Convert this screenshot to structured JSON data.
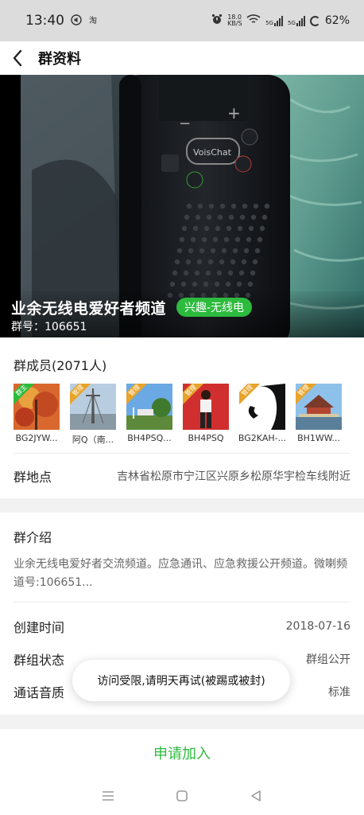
{
  "status_bar": {
    "time": "13:40",
    "net_speed_top": "18.0",
    "net_speed_bottom": "KB/S",
    "signal_label_1": "5G",
    "signal_label_2": "5G",
    "battery": "62%"
  },
  "header": {
    "title": "群资料"
  },
  "cover": {
    "group_name": "业余无线电爱好者频道",
    "tag": "兴趣-无线电",
    "group_id": "群号：106651"
  },
  "members": {
    "title": "群成员(2071人)",
    "badge_owner": "群主",
    "badge_admin": "管理",
    "list": [
      {
        "name": "BG2JYW...",
        "badge": "群主"
      },
      {
        "name": "阿Q（南...",
        "badge": "管理"
      },
      {
        "name": "BH4PSQ...",
        "badge": "管理"
      },
      {
        "name": "BH4PSQ",
        "badge": "管理"
      },
      {
        "name": "BG2KAH-...",
        "badge": "管理"
      },
      {
        "name": "BH1WW...",
        "badge": "管理"
      }
    ]
  },
  "location": {
    "label": "群地点",
    "value": "吉林省松原市宁江区兴原乡松原华宇检车线附近"
  },
  "intro": {
    "title": "群介绍",
    "text": "业余无线电爱好者交流频道。应急通讯、应急救援公开频道。微喇频道号:106651..."
  },
  "info": {
    "created_label": "创建时间",
    "created_value": "2018-07-16",
    "status_label": "群组状态",
    "status_value": "群组公开",
    "quality_label": "通话音质",
    "quality_value": "标准"
  },
  "toast": {
    "text": "访问受限,请明天再试(被踢或被封)"
  },
  "footer": {
    "join_label": "申请加入"
  },
  "colors": {
    "accent": "#2dbb3e",
    "admin_badge": "#e8a32a"
  }
}
